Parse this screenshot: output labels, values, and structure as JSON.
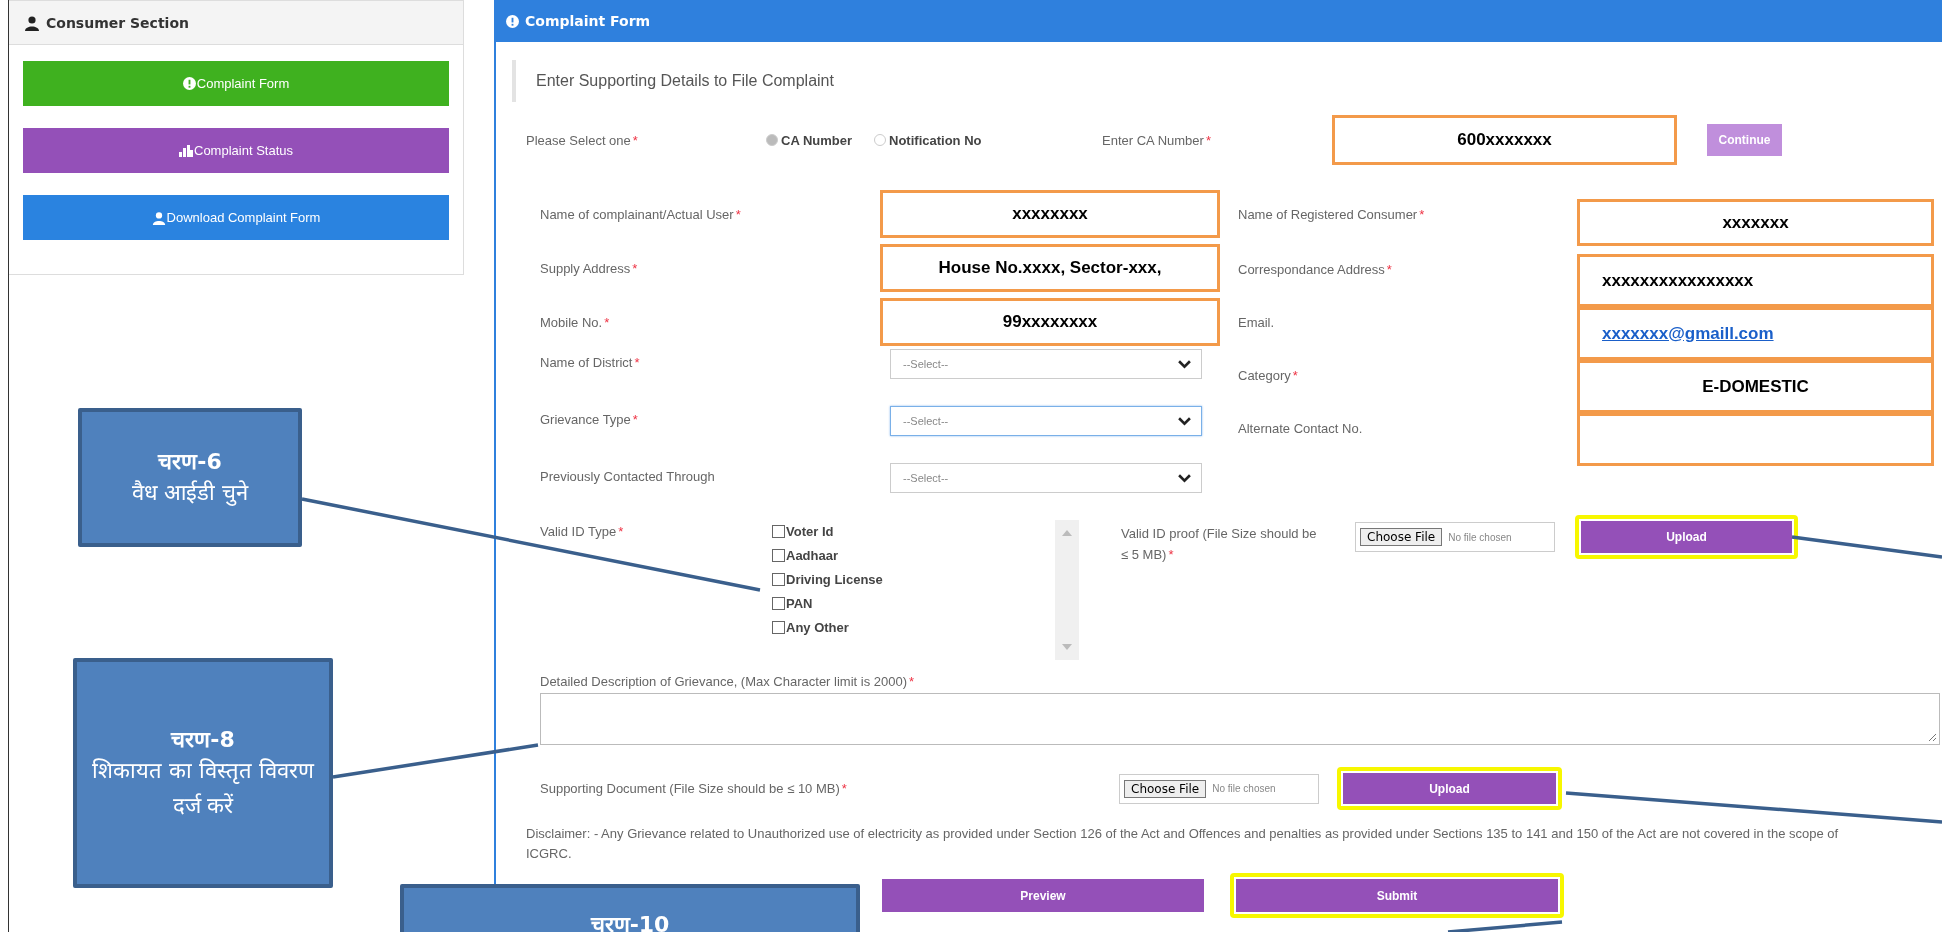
{
  "sidebar": {
    "title": "Consumer Section",
    "items": [
      {
        "label": "Complaint Form",
        "color": "#3fb11f"
      },
      {
        "label": "Complaint Status",
        "color": "#9450b8"
      },
      {
        "label": "Download Complaint Form",
        "color": "#2a83e0"
      }
    ]
  },
  "form": {
    "title": "Complaint Form",
    "subtitle": "Enter Supporting Details to File Complaint",
    "lookup": {
      "label": "Please Select one",
      "mark": "*",
      "options": [
        {
          "label": "CA Number",
          "selected": true
        },
        {
          "label": "Notification No",
          "selected": false
        }
      ],
      "ca_label": "Enter CA Number",
      "ca_mark": "*",
      "ca_value": "600xxxxxxx",
      "continue": {
        "label": "Continue"
      }
    },
    "left_fields": [
      {
        "kind": "text",
        "label": "Name of complainant/Actual User",
        "mark": "*",
        "value": "xxxxxxxx"
      },
      {
        "kind": "text",
        "label": "Supply Address",
        "mark": "*",
        "value": "House No.xxxx, Sector-xxx,"
      },
      {
        "kind": "text",
        "label": "Mobile No.",
        "mark": "*",
        "value": "99xxxxxxxx"
      },
      {
        "kind": "select",
        "label": "Name of District",
        "mark": "*",
        "placeholder": "--Select--",
        "focused": false
      },
      {
        "kind": "select",
        "label": "Grievance Type",
        "mark": "*",
        "placeholder": "--Select--",
        "focused": true
      },
      {
        "kind": "select",
        "label": "Previously Contacted Through",
        "placeholder": "--Select--",
        "focused": false
      }
    ],
    "right_fields": [
      {
        "kind": "text",
        "label": "Name of Registered Consumer",
        "mark": "*",
        "value": "xxxxxxx"
      },
      {
        "kind": "text",
        "label": "Correspondance Address",
        "mark": "*",
        "value": "xxxxxxxxxxxxxxxx"
      },
      {
        "kind": "link",
        "label": "Email.",
        "value": "xxxxxxx@gmaill.com"
      },
      {
        "kind": "text",
        "label": "Category",
        "mark": "*",
        "value": "E-DOMESTIC"
      },
      {
        "kind": "text",
        "label": "Alternate Contact No."
      }
    ],
    "valid_id": {
      "label": "Valid ID Type",
      "mark": "*",
      "options": [
        {
          "label": "Voter Id",
          "checked": false
        },
        {
          "label": "Aadhaar",
          "checked": false
        },
        {
          "label": "Driving License",
          "checked": false
        },
        {
          "label": "PAN",
          "checked": false
        },
        {
          "label": "Any Other",
          "checked": false
        }
      ],
      "proof_label": "Valid ID proof (File Size should be ≤ 5 MB)",
      "proof_mark": "*",
      "file_button": "Choose File",
      "file_status": "No file chosen",
      "upload": {
        "label": "Upload",
        "highlighted": true
      }
    },
    "description": {
      "label": "Detailed Description of Grievance, (Max Character limit is 2000)",
      "mark": "*"
    },
    "supporting": {
      "label": "Supporting Document (File Size should be ≤ 10 MB)",
      "mark": "*",
      "file_button": "Choose File",
      "file_status": "No file chosen",
      "upload": {
        "label": "Upload",
        "highlighted": true
      }
    },
    "disclaimer": "Disclaimer: - Any Grievance related to Unauthorized use of electricity as provided under Section 126 of the Act and Offences and penalties as provided under Sections 135 to 141 and 150 of the Act are not covered in the scope of ICGRC.",
    "actions": [
      {
        "label": "Preview"
      },
      {
        "label": "Submit",
        "highlighted": true
      }
    ]
  },
  "callouts": [
    {
      "title": "चरण-6",
      "text": "वैध आईडी चुने"
    },
    {
      "title": "चरण-8",
      "text": "शिकायत का विस्तृत विवरण दर्ज करें"
    },
    {
      "title": "चरण-10"
    }
  ]
}
